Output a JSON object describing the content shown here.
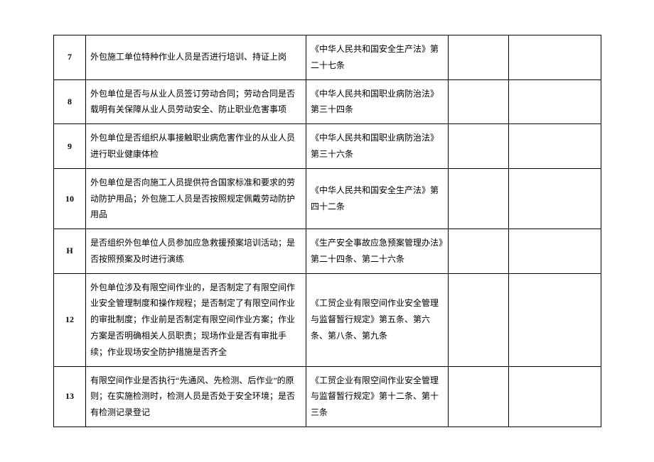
{
  "rows": [
    {
      "num": "7",
      "desc": "外包施工单位特种作业人员是否进行培训、持证上岗",
      "law": "《中华人民共和国安全生产法》第二十七条"
    },
    {
      "num": "8",
      "desc": "外包单位是否与从业人员签订劳动合同；劳动合同是否载明有关保障从业人员劳动安全、防止职业危害事项",
      "law": "《中华人民共和国职业病防治法》第三十四条"
    },
    {
      "num": "9",
      "desc": "外包单位是否组织从事接触职业病危害作业的从业人员进行职业健康体检",
      "law": "《中华人民共和国职业病防治法》第三十六条"
    },
    {
      "num": "10",
      "desc": "外包单位是否向施工人员提供符合国家标准和要求的劳动防护用品；外包施工人员是否按照规定佩戴劳动防护用品",
      "law": "《中华人民共和国安全生产法》第四十二条"
    },
    {
      "num": "H",
      "desc": "是否组织外包单位人员参加应急救援预案培训活动；是否按照预案及时进行演练",
      "law": "《生产安全事故应急预案管理办法》第二十四条、第二十六条"
    },
    {
      "num": "12",
      "desc": "外包单位涉及有限空间作业的，是否制定了有限空间作业安全管理制度和操作规程；是否制定了有限空间作业的审批制度；作业前是否制定有限空间作业方案；作业方案是否明确相关人员职责；现场作业是否有审批手续；作业现场安全防护措施是否齐全",
      "law": "《工贸企业有限空间作业安全管理与监督暂行规定》第五条、第六条、第八条、第九条"
    },
    {
      "num": "13",
      "desc": "有限空间作业是否执行“先通风、先检测、后作业”的原则；在实施检测时，检测人员是否处于安全环境；是否有检测记录登记",
      "law": "《工贸企业有限空间作业安全管理与监督暂行规定》第十二条、第十三条"
    }
  ]
}
